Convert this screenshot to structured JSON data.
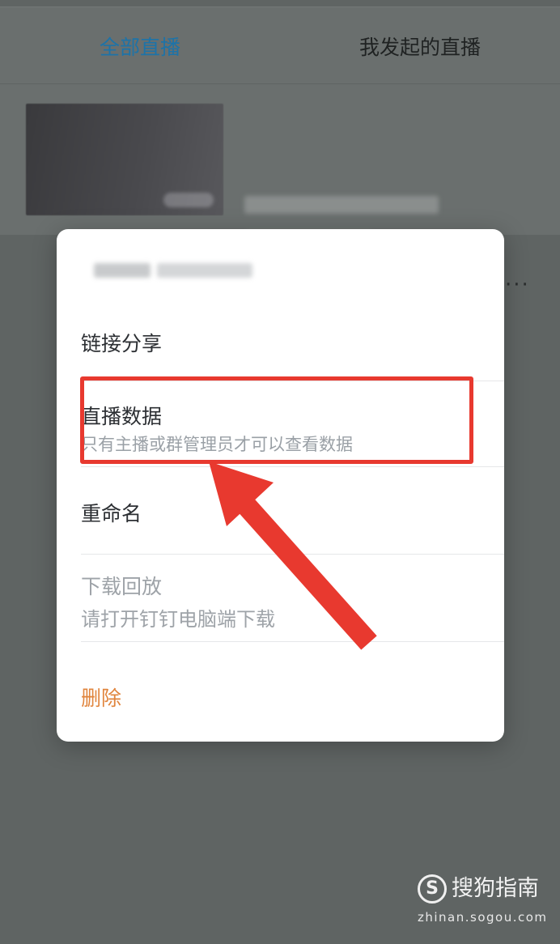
{
  "tabs": [
    {
      "label": "全部直播",
      "active": true
    },
    {
      "label": "我发起的直播",
      "active": false
    }
  ],
  "colors": {
    "accent": "#1d73a8",
    "delete": "#e0843c",
    "highlight": "#e8392f",
    "overlay": "#5f6463"
  },
  "list_item": {
    "share_icon": "share-arrow-icon",
    "more_icon": "more-dots-icon",
    "more_glyph": "···"
  },
  "menu": {
    "share": {
      "label": "链接分享"
    },
    "live_data": {
      "label": "直播数据",
      "sub": "只有主播或群管理员才可以查看数据"
    },
    "rename": {
      "label": "重命名"
    },
    "download": {
      "label": "下载回放",
      "sub": "请打开钉钉电脑端下载"
    },
    "delete": {
      "label": "删除"
    }
  },
  "watermark": {
    "logo": "S",
    "title": "搜狗指南",
    "url": "zhinan.sogou.com"
  }
}
